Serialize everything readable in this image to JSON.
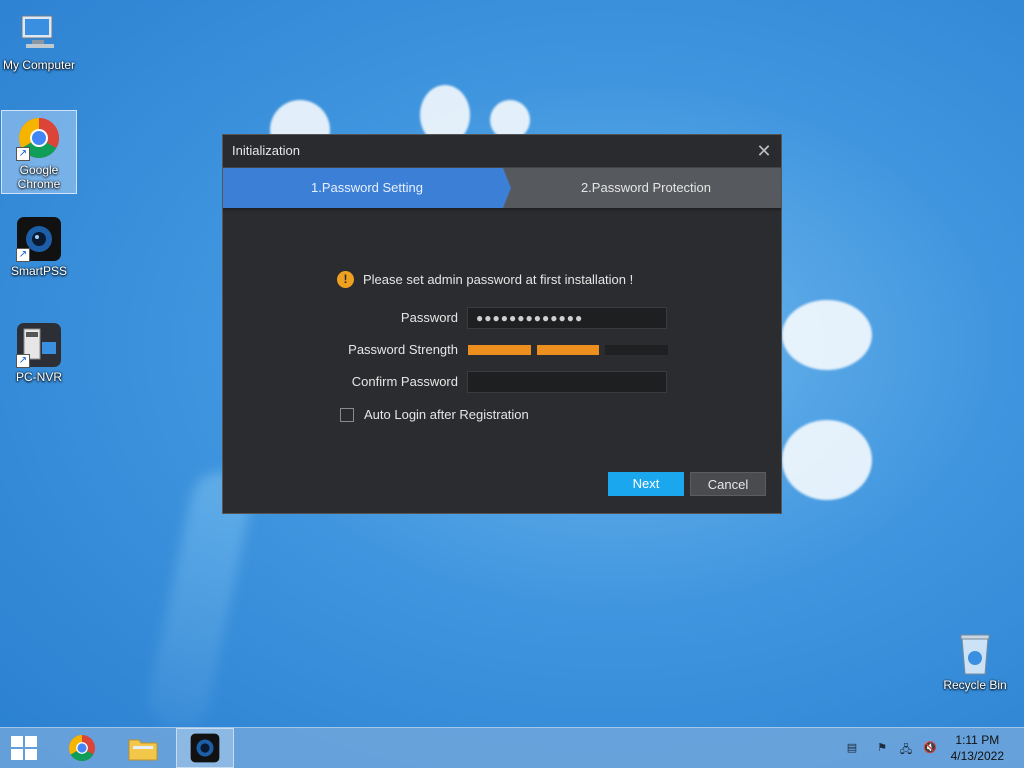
{
  "desktop": {
    "icons": [
      {
        "label": "My Computer"
      },
      {
        "label": "Google Chrome"
      },
      {
        "label": "SmartPSS"
      },
      {
        "label": "PC-NVR"
      },
      {
        "label": "Recycle Bin"
      }
    ]
  },
  "dialog": {
    "title": "Initialization",
    "steps": [
      "1.Password Setting",
      "2.Password Protection"
    ],
    "notice": "Please set admin password at first installation !",
    "password_label": "Password",
    "password_value": "●●●●●●●●●●●●●",
    "strength_label": "Password Strength",
    "strength_level": 2,
    "strength_total": 3,
    "confirm_label": "Confirm Password",
    "confirm_value": "",
    "auto_login_label": "Auto Login after Registration",
    "auto_login_checked": false,
    "next_label": "Next",
    "cancel_label": "Cancel"
  },
  "taskbar": {
    "time": "1:11 PM",
    "date": "4/13/2022"
  },
  "colors": {
    "accent_step": "#3b7fd6",
    "next_button": "#1aa7ee",
    "strength": "#ec8f1e"
  }
}
